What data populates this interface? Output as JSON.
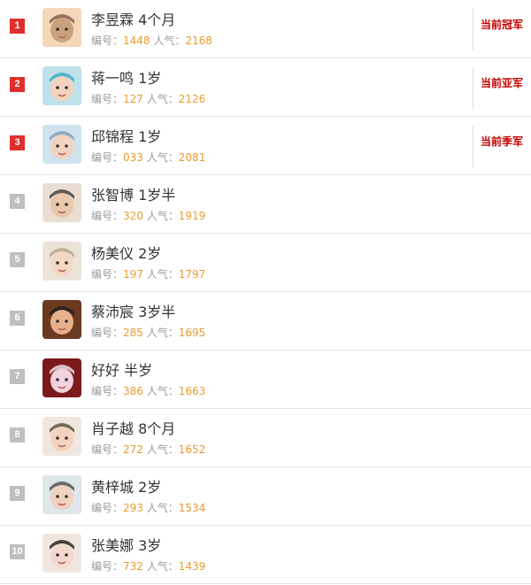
{
  "list": [
    {
      "rank": "1",
      "name": "李昱霖 4个月",
      "id_label": "编号：",
      "id": "1448",
      "pop_label": "人气：",
      "pop": "2168",
      "badge": "当前冠军",
      "avatar_icon": "baby-photo-icon",
      "colors": [
        "#f4d6b8",
        "#c9a27d",
        "#7b5a44"
      ]
    },
    {
      "rank": "2",
      "name": "蒋一鸣 1岁",
      "id_label": "编号：",
      "id": "127",
      "pop_label": "人气：",
      "pop": "2126",
      "badge": "当前亚军",
      "avatar_icon": "baby-photo-icon",
      "colors": [
        "#bde0ea",
        "#f3d2be",
        "#3aa7c1"
      ]
    },
    {
      "rank": "3",
      "name": "邱锦程 1岁",
      "id_label": "编号：",
      "id": "033",
      "pop_label": "人气：",
      "pop": "2081",
      "badge": "当前季军",
      "avatar_icon": "baby-photo-icon",
      "colors": [
        "#cfe3ef",
        "#f2d3c0",
        "#7f9fb8"
      ]
    },
    {
      "rank": "4",
      "name": "张智博 1岁半",
      "id_label": "编号：",
      "id": "320",
      "pop_label": "人气：",
      "pop": "1919",
      "badge": "",
      "avatar_icon": "baby-photo-icon",
      "colors": [
        "#eaded2",
        "#e8c7aa",
        "#3a3a3a"
      ]
    },
    {
      "rank": "5",
      "name": "杨美仪 2岁",
      "id_label": "编号：",
      "id": "197",
      "pop_label": "人气：",
      "pop": "1797",
      "badge": "",
      "avatar_icon": "baby-photo-icon",
      "colors": [
        "#ece3d8",
        "#f2d7c2",
        "#b9a28b"
      ]
    },
    {
      "rank": "6",
      "name": "蔡沛宸 3岁半",
      "id_label": "编号：",
      "id": "285",
      "pop_label": "人气：",
      "pop": "1695",
      "badge": "",
      "avatar_icon": "baby-photo-icon",
      "colors": [
        "#6b3a20",
        "#e8b08a",
        "#1e1e1e"
      ]
    },
    {
      "rank": "7",
      "name": "好好 半岁",
      "id_label": "编号：",
      "id": "386",
      "pop_label": "人气：",
      "pop": "1663",
      "badge": "",
      "avatar_icon": "baby-photo-icon",
      "colors": [
        "#7a1a1a",
        "#f1d2dd",
        "#f6e9ee"
      ]
    },
    {
      "rank": "8",
      "name": "肖子越 8个月",
      "id_label": "编号：",
      "id": "272",
      "pop_label": "人气：",
      "pop": "1652",
      "badge": "",
      "avatar_icon": "baby-photo-icon",
      "colors": [
        "#efe7df",
        "#f3d3bd",
        "#5a4a3a"
      ]
    },
    {
      "rank": "9",
      "name": "黄梓城 2岁",
      "id_label": "编号：",
      "id": "293",
      "pop_label": "人气：",
      "pop": "1534",
      "badge": "",
      "avatar_icon": "baby-photo-icon",
      "colors": [
        "#dfe6e9",
        "#f1d1bf",
        "#4a4a4a"
      ]
    },
    {
      "rank": "10",
      "name": "张美娜 3岁",
      "id_label": "编号：",
      "id": "732",
      "pop_label": "人气：",
      "pop": "1439",
      "badge": "",
      "avatar_icon": "baby-photo-icon",
      "colors": [
        "#efe6df",
        "#f3d9cd",
        "#1a1a1a"
      ]
    }
  ],
  "colors": {
    "rank_top": "#e02e2e",
    "rank_rest": "#bfbfbf",
    "badge": "#c40000",
    "num": "#ea9a2e"
  }
}
